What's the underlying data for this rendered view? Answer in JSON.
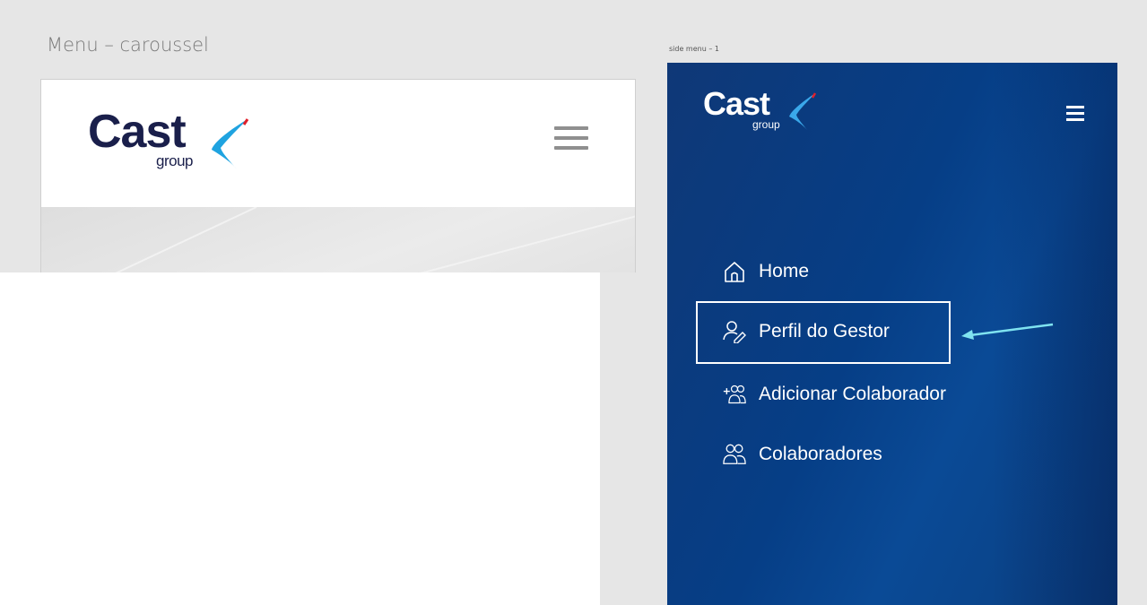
{
  "left_section": {
    "title": "Menu – caroussel",
    "logo": {
      "word": "Cast",
      "sub": "group"
    }
  },
  "right_section": {
    "label": "side menu – 1",
    "logo": {
      "word": "Cast",
      "sub": "group"
    },
    "menu_items": [
      {
        "label": "Home",
        "icon": "home-icon"
      },
      {
        "label": "Perfil do Gestor",
        "icon": "user-edit-icon",
        "highlighted": true
      },
      {
        "label": "Adicionar Colaborador",
        "icon": "add-users-icon"
      },
      {
        "label": "Colaboradores",
        "icon": "users-icon"
      }
    ]
  },
  "colors": {
    "panel_blue": "#0a4290",
    "brand_dark": "#1a1f4b",
    "highlight_arrow": "#7fe3f0"
  }
}
